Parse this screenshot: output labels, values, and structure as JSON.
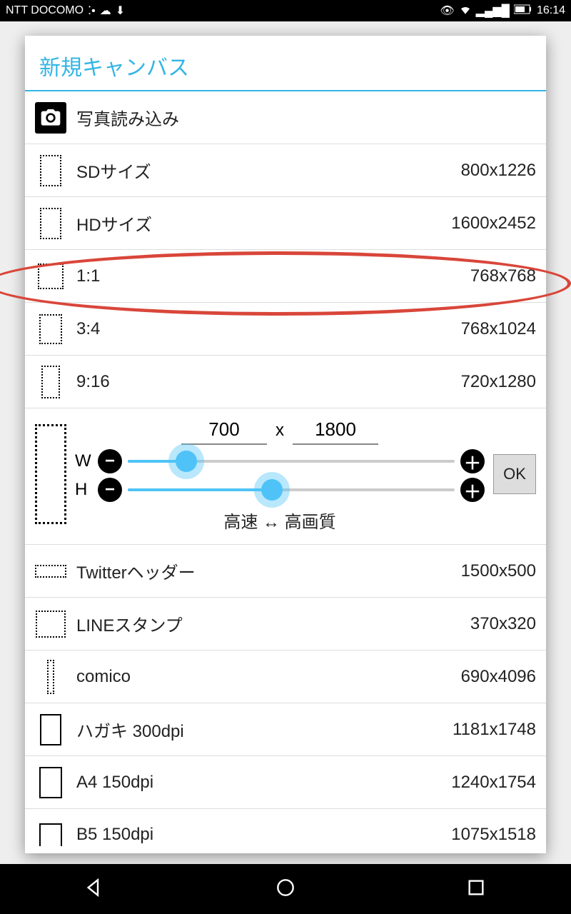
{
  "status": {
    "carrier": "NTT DOCOMO",
    "time": "16:14"
  },
  "dialog": {
    "title": "新規キャンバス",
    "photo_load": "写真読み込み",
    "items": [
      {
        "label": "SDサイズ",
        "size": "800x1226"
      },
      {
        "label": "HDサイズ",
        "size": "1600x2452"
      },
      {
        "label": "1:1",
        "size": "768x768"
      },
      {
        "label": "3:4",
        "size": "768x1024"
      },
      {
        "label": "9:16",
        "size": "720x1280"
      }
    ],
    "custom": {
      "width_value": "700",
      "height_value": "1800",
      "separator": "x",
      "w_label": "W",
      "h_label": "H",
      "minus": "−",
      "plus": "＋",
      "quality_text": "高速 ↔ 高画質",
      "ok": "OK"
    },
    "items2": [
      {
        "label": "Twitterヘッダー",
        "size": "1500x500"
      },
      {
        "label": "LINEスタンプ",
        "size": "370x320"
      },
      {
        "label": "comico",
        "size": "690x4096"
      },
      {
        "label": "ハガキ 300dpi",
        "size": "1181x1748"
      },
      {
        "label": "A4 150dpi",
        "size": "1240x1754"
      },
      {
        "label": "B5 150dpi",
        "size": "1075x1518"
      }
    ]
  }
}
